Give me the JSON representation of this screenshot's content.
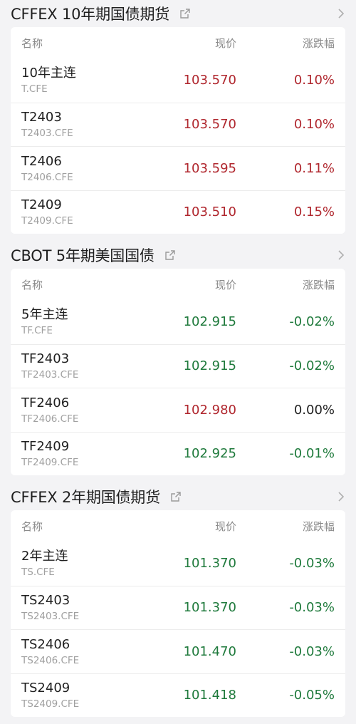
{
  "colors": {
    "up": "#b0272e",
    "down": "#1f7a3c",
    "flat": "#222222"
  },
  "sections": [
    {
      "title": "CFFEX 10年期国债期货",
      "headers": {
        "name": "名称",
        "price": "现价",
        "change": "涨跌幅"
      },
      "rows": [
        {
          "name": "10年主连",
          "code": "T.CFE",
          "price": "103.570",
          "change": "0.10%",
          "price_dir": "up",
          "change_dir": "up"
        },
        {
          "name": "T2403",
          "code": "T2403.CFE",
          "price": "103.570",
          "change": "0.10%",
          "price_dir": "up",
          "change_dir": "up"
        },
        {
          "name": "T2406",
          "code": "T2406.CFE",
          "price": "103.595",
          "change": "0.11%",
          "price_dir": "up",
          "change_dir": "up"
        },
        {
          "name": "T2409",
          "code": "T2409.CFE",
          "price": "103.510",
          "change": "0.15%",
          "price_dir": "up",
          "change_dir": "up"
        }
      ]
    },
    {
      "title": "CBOT 5年期美国国债",
      "headers": {
        "name": "名称",
        "price": "现价",
        "change": "涨跌幅"
      },
      "rows": [
        {
          "name": "5年主连",
          "code": "TF.CFE",
          "price": "102.915",
          "change": "-0.02%",
          "price_dir": "down",
          "change_dir": "down"
        },
        {
          "name": "TF2403",
          "code": "TF2403.CFE",
          "price": "102.915",
          "change": "-0.02%",
          "price_dir": "down",
          "change_dir": "down"
        },
        {
          "name": "TF2406",
          "code": "TF2406.CFE",
          "price": "102.980",
          "change": "0.00%",
          "price_dir": "up",
          "change_dir": "flat"
        },
        {
          "name": "TF2409",
          "code": "TF2409.CFE",
          "price": "102.925",
          "change": "-0.01%",
          "price_dir": "down",
          "change_dir": "down"
        }
      ]
    },
    {
      "title": "CFFEX 2年期国债期货",
      "headers": {
        "name": "名称",
        "price": "现价",
        "change": "涨跌幅"
      },
      "rows": [
        {
          "name": "2年主连",
          "code": "TS.CFE",
          "price": "101.370",
          "change": "-0.03%",
          "price_dir": "down",
          "change_dir": "down"
        },
        {
          "name": "TS2403",
          "code": "TS2403.CFE",
          "price": "101.370",
          "change": "-0.03%",
          "price_dir": "down",
          "change_dir": "down"
        },
        {
          "name": "TS2406",
          "code": "TS2406.CFE",
          "price": "101.470",
          "change": "-0.03%",
          "price_dir": "down",
          "change_dir": "down"
        },
        {
          "name": "TS2409",
          "code": "TS2409.CFE",
          "price": "101.418",
          "change": "-0.05%",
          "price_dir": "down",
          "change_dir": "down"
        }
      ]
    }
  ],
  "icons": {
    "share": "external-link-icon",
    "more": "chevron-right-icon"
  }
}
